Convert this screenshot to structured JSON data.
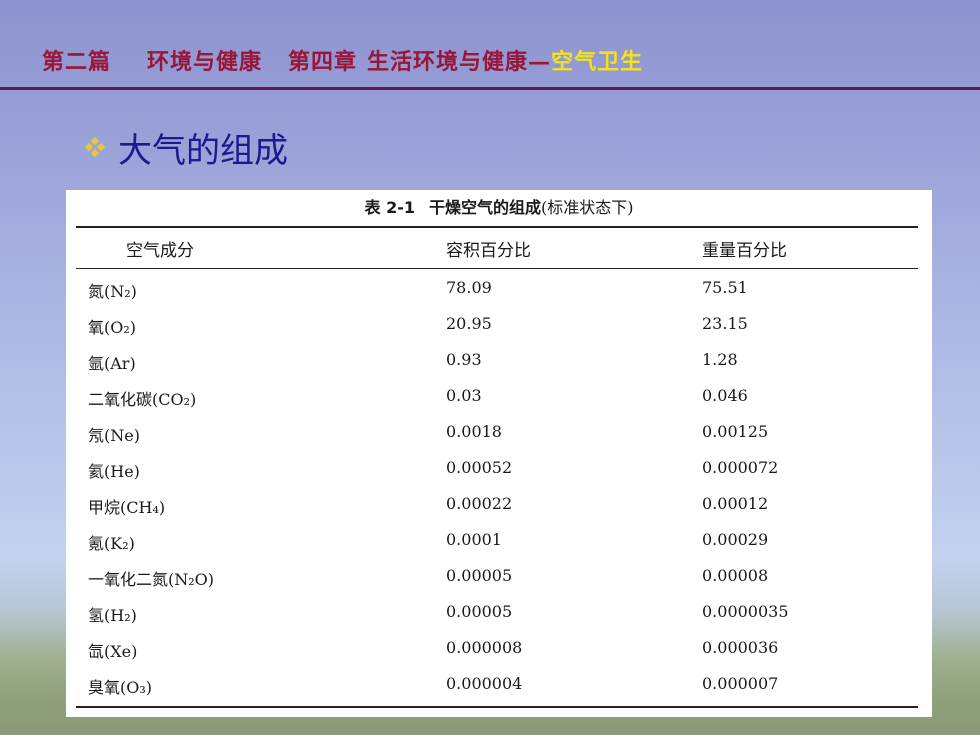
{
  "header": {
    "part": "第二篇",
    "part_title": "环境与健康",
    "chapter": "第四章",
    "chapter_title": "生活环境与健康—",
    "section": "空气卫生"
  },
  "heading": {
    "bullet_icon": "diamond-bullet-icon",
    "text": "大气的组成"
  },
  "table": {
    "caption_number": "表 2-1",
    "caption_title": "干燥空气的组成",
    "caption_note": "(标准状态下)",
    "columns": [
      "空气成分",
      "容积百分比",
      "重量百分比"
    ],
    "rows": [
      {
        "component": "氮(N₂)",
        "volume": "78.09",
        "weight": "75.51"
      },
      {
        "component": "氧(O₂)",
        "volume": "20.95",
        "weight": "23.15"
      },
      {
        "component": "氩(Ar)",
        "volume": "0.93",
        "weight": "1.28"
      },
      {
        "component": "二氧化碳(CO₂)",
        "volume": "0.03",
        "weight": "0.046"
      },
      {
        "component": "氖(Ne)",
        "volume": "0.0018",
        "weight": "0.00125"
      },
      {
        "component": "氦(He)",
        "volume": "0.00052",
        "weight": "0.000072"
      },
      {
        "component": "甲烷(CH₄)",
        "volume": "0.00022",
        "weight": "0.00012"
      },
      {
        "component": "氪(K₂)",
        "volume": "0.0001",
        "weight": "0.00029"
      },
      {
        "component": "一氧化二氮(N₂O)",
        "volume": "0.00005",
        "weight": "0.00008"
      },
      {
        "component": "氢(H₂)",
        "volume": "0.00005",
        "weight": "0.0000035"
      },
      {
        "component": "氙(Xe)",
        "volume": "0.000008",
        "weight": "0.000036"
      },
      {
        "component": "臭氧(O₃)",
        "volume": "0.000004",
        "weight": "0.000007"
      }
    ]
  },
  "colors": {
    "header_text": "#9a1538",
    "header_accent": "#f5e21a",
    "header_rule": "#5d1a4d",
    "heading_text": "#1c1a8e",
    "bullet": "#e8c83a"
  }
}
